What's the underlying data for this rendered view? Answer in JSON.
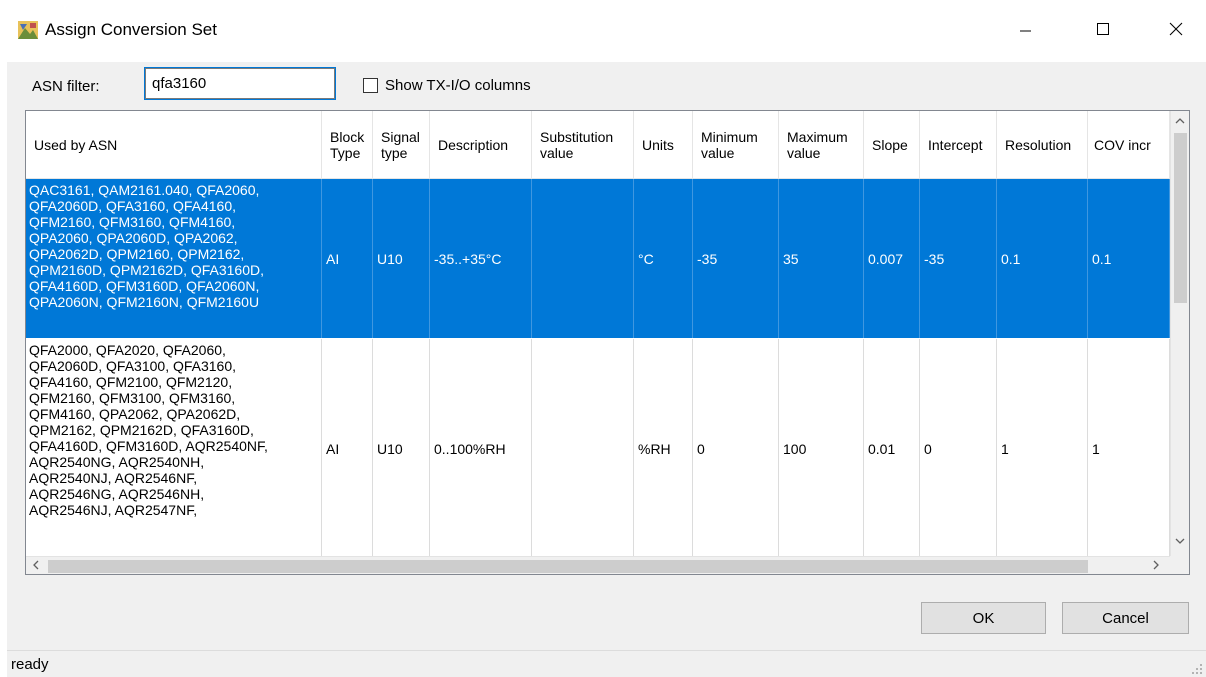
{
  "window": {
    "title": "Assign Conversion Set"
  },
  "filter": {
    "label": "ASN filter:",
    "value": "qfa3160",
    "show_txio_label": "Show TX-I/O columns",
    "show_txio_checked": false
  },
  "grid": {
    "columns": [
      "Used by ASN",
      "Block Type",
      "Signal type",
      "Description",
      "Substitution value",
      "Units",
      "Minimum value",
      "Maximum value",
      "Slope",
      "Intercept",
      "Resolution",
      "COV incr"
    ],
    "rows": [
      {
        "selected": true,
        "asn": "QAC3161, QAM2161.040, QFA2060,\nQFA2060D, QFA3160, QFA4160,\nQFM2160, QFM3160, QFM4160,\nQPA2060, QPA2060D, QPA2062,\nQPA2062D, QPM2160, QPM2162,\nQPM2160D, QPM2162D, QFA3160D,\nQFA4160D, QFM3160D, QFA2060N,\nQPA2060N, QFM2160N, QFM2160U",
        "block_type": "AI",
        "signal_type": "U10",
        "description": "-35..+35°C",
        "substitution": "",
        "units": "°C",
        "min": "-35",
        "max": "35",
        "slope": "0.007",
        "intercept": "-35",
        "resolution": "0.1",
        "cov": "0.1"
      },
      {
        "selected": false,
        "asn": "QFA2000, QFA2020, QFA2060,\nQFA2060D, QFA3100, QFA3160,\nQFA4160, QFM2100, QFM2120,\nQFM2160, QFM3100, QFM3160,\nQFM4160, QPA2062, QPA2062D,\nQPM2162, QPM2162D, QFA3160D,\nQFA4160D, QFM3160D, AQR2540NF,\nAQR2540NG, AQR2540NH,\nAQR2540NJ, AQR2546NF,\nAQR2546NG, AQR2546NH,\nAQR2546NJ, AQR2547NF,",
        "block_type": "AI",
        "signal_type": "U10",
        "description": "0..100%RH",
        "substitution": "",
        "units": "%RH",
        "min": "0",
        "max": "100",
        "slope": "0.01",
        "intercept": "0",
        "resolution": "1",
        "cov": "1"
      }
    ]
  },
  "buttons": {
    "ok": "OK",
    "cancel": "Cancel"
  },
  "status": {
    "text": "ready"
  },
  "colors": {
    "selection": "#0078d7",
    "window_bg": "#f0f0f0"
  },
  "icons": {
    "app": "conversion-set-icon",
    "minimize": "minimize-icon",
    "maximize": "maximize-icon",
    "close": "close-icon"
  }
}
